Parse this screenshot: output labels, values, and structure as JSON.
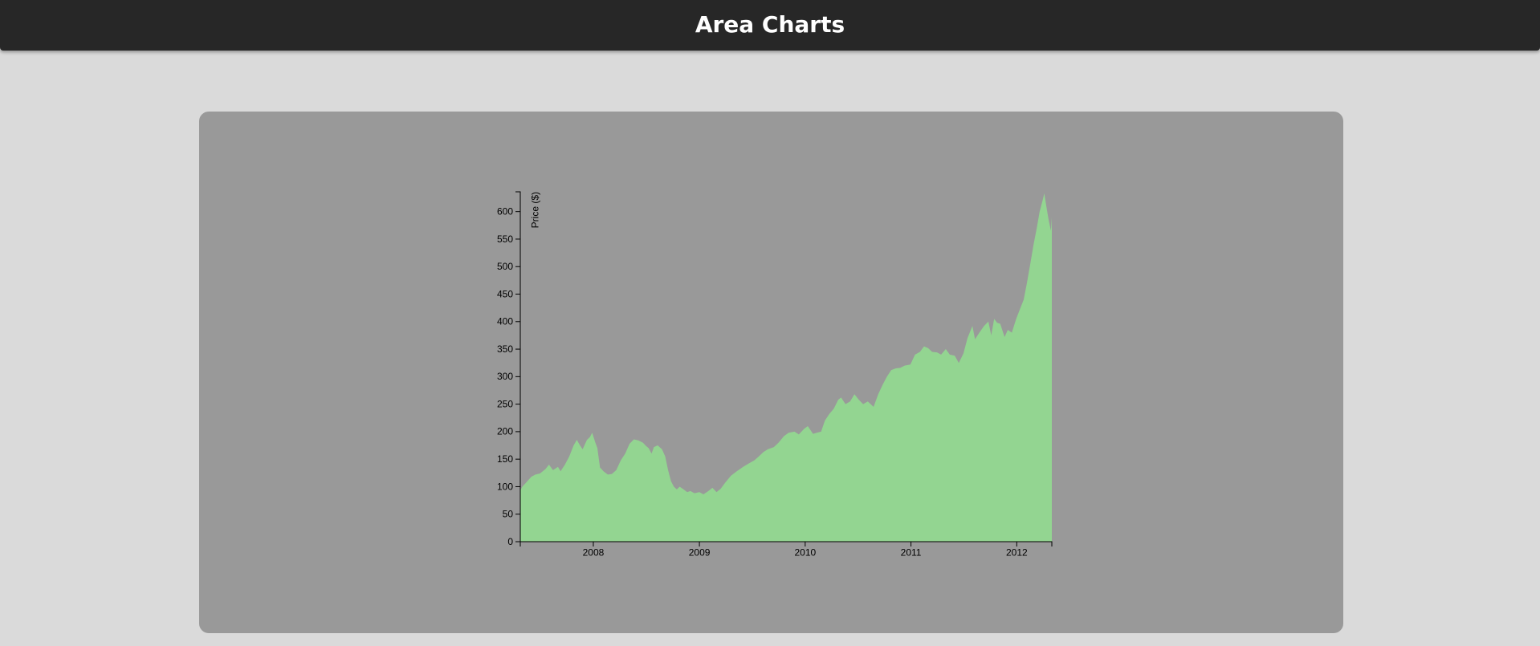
{
  "header": {
    "title": "Area Charts"
  },
  "colors": {
    "header_bg": "#272727",
    "page_bg": "#dadada",
    "panel_bg": "#999999",
    "area_fill": "#93d591"
  },
  "chart_data": {
    "type": "area",
    "ylabel": "Price ($)",
    "xlabel": "",
    "x_ticks": [
      "2008",
      "2009",
      "2010",
      "2011",
      "2012"
    ],
    "y_ticks": [
      0,
      50,
      100,
      150,
      200,
      250,
      300,
      350,
      400,
      450,
      500,
      550,
      600
    ],
    "xlim": [
      "2007-04-24",
      "2012-05-01"
    ],
    "ylim": [
      0,
      636
    ],
    "grid": false,
    "legend": "none",
    "series": [
      {
        "points": [
          [
            "2007-04-24",
            93
          ],
          [
            "2007-05-01",
            100
          ],
          [
            "2007-05-15",
            108
          ],
          [
            "2007-06-01",
            118
          ],
          [
            "2007-06-15",
            122
          ],
          [
            "2007-07-01",
            124
          ],
          [
            "2007-07-20",
            132
          ],
          [
            "2007-08-01",
            140
          ],
          [
            "2007-08-15",
            130
          ],
          [
            "2007-09-01",
            136
          ],
          [
            "2007-09-10",
            128
          ],
          [
            "2007-09-25",
            140
          ],
          [
            "2007-10-10",
            155
          ],
          [
            "2007-10-25",
            175
          ],
          [
            "2007-11-05",
            185
          ],
          [
            "2007-11-15",
            176
          ],
          [
            "2007-11-25",
            168
          ],
          [
            "2007-12-10",
            185
          ],
          [
            "2007-12-20",
            190
          ],
          [
            "2007-12-28",
            198
          ],
          [
            "2008-01-08",
            180
          ],
          [
            "2008-01-15",
            170
          ],
          [
            "2008-01-24",
            135
          ],
          [
            "2008-02-05",
            128
          ],
          [
            "2008-02-20",
            122
          ],
          [
            "2008-03-05",
            123
          ],
          [
            "2008-03-20",
            130
          ],
          [
            "2008-04-05",
            148
          ],
          [
            "2008-04-20",
            160
          ],
          [
            "2008-05-05",
            178
          ],
          [
            "2008-05-20",
            186
          ],
          [
            "2008-06-05",
            184
          ],
          [
            "2008-06-20",
            180
          ],
          [
            "2008-07-01",
            174
          ],
          [
            "2008-07-10",
            170
          ],
          [
            "2008-07-20",
            160
          ],
          [
            "2008-07-28",
            172
          ],
          [
            "2008-08-10",
            175
          ],
          [
            "2008-08-25",
            168
          ],
          [
            "2008-09-05",
            155
          ],
          [
            "2008-09-15",
            130
          ],
          [
            "2008-09-25",
            110
          ],
          [
            "2008-10-05",
            100
          ],
          [
            "2008-10-15",
            95
          ],
          [
            "2008-10-25",
            100
          ],
          [
            "2008-11-05",
            96
          ],
          [
            "2008-11-20",
            90
          ],
          [
            "2008-12-01",
            92
          ],
          [
            "2008-12-15",
            88
          ],
          [
            "2009-01-01",
            90
          ],
          [
            "2009-01-15",
            86
          ],
          [
            "2009-02-01",
            92
          ],
          [
            "2009-02-15",
            98
          ],
          [
            "2009-03-01",
            90
          ],
          [
            "2009-03-15",
            96
          ],
          [
            "2009-04-01",
            108
          ],
          [
            "2009-04-20",
            120
          ],
          [
            "2009-05-10",
            128
          ],
          [
            "2009-06-01",
            136
          ],
          [
            "2009-06-20",
            142
          ],
          [
            "2009-07-10",
            148
          ],
          [
            "2009-07-25",
            155
          ],
          [
            "2009-08-10",
            163
          ],
          [
            "2009-08-25",
            168
          ],
          [
            "2009-09-15",
            172
          ],
          [
            "2009-10-01",
            180
          ],
          [
            "2009-10-20",
            192
          ],
          [
            "2009-11-05",
            198
          ],
          [
            "2009-11-25",
            200
          ],
          [
            "2009-12-10",
            195
          ],
          [
            "2009-12-28",
            205
          ],
          [
            "2010-01-10",
            210
          ],
          [
            "2010-01-28",
            196
          ],
          [
            "2010-02-10",
            198
          ],
          [
            "2010-02-25",
            200
          ],
          [
            "2010-03-10",
            220
          ],
          [
            "2010-03-25",
            232
          ],
          [
            "2010-04-10",
            242
          ],
          [
            "2010-04-25",
            258
          ],
          [
            "2010-05-05",
            262
          ],
          [
            "2010-05-20",
            250
          ],
          [
            "2010-06-05",
            255
          ],
          [
            "2010-06-20",
            268
          ],
          [
            "2010-07-05",
            258
          ],
          [
            "2010-07-20",
            250
          ],
          [
            "2010-08-05",
            255
          ],
          [
            "2010-08-25",
            245
          ],
          [
            "2010-09-10",
            268
          ],
          [
            "2010-09-25",
            285
          ],
          [
            "2010-10-10",
            300
          ],
          [
            "2010-10-25",
            312
          ],
          [
            "2010-11-10",
            315
          ],
          [
            "2010-11-25",
            316
          ],
          [
            "2010-12-10",
            320
          ],
          [
            "2010-12-30",
            322
          ],
          [
            "2011-01-15",
            340
          ],
          [
            "2011-02-01",
            345
          ],
          [
            "2011-02-15",
            355
          ],
          [
            "2011-03-01",
            352
          ],
          [
            "2011-03-15",
            345
          ],
          [
            "2011-04-01",
            344
          ],
          [
            "2011-04-15",
            340
          ],
          [
            "2011-05-01",
            350
          ],
          [
            "2011-05-15",
            340
          ],
          [
            "2011-06-01",
            338
          ],
          [
            "2011-06-15",
            325
          ],
          [
            "2011-07-01",
            342
          ],
          [
            "2011-07-15",
            370
          ],
          [
            "2011-08-01",
            392
          ],
          [
            "2011-08-10",
            368
          ],
          [
            "2011-08-25",
            380
          ],
          [
            "2011-09-10",
            392
          ],
          [
            "2011-09-25",
            400
          ],
          [
            "2011-10-05",
            375
          ],
          [
            "2011-10-15",
            405
          ],
          [
            "2011-10-25",
            398
          ],
          [
            "2011-11-05",
            396
          ],
          [
            "2011-11-20",
            372
          ],
          [
            "2011-12-01",
            385
          ],
          [
            "2011-12-15",
            380
          ],
          [
            "2011-12-30",
            405
          ],
          [
            "2012-01-10",
            420
          ],
          [
            "2012-01-25",
            440
          ],
          [
            "2012-02-05",
            470
          ],
          [
            "2012-02-15",
            500
          ],
          [
            "2012-02-28",
            540
          ],
          [
            "2012-03-10",
            570
          ],
          [
            "2012-03-20",
            600
          ],
          [
            "2012-03-30",
            620
          ],
          [
            "2012-04-05",
            633
          ],
          [
            "2012-04-12",
            610
          ],
          [
            "2012-04-20",
            585
          ],
          [
            "2012-04-28",
            565
          ],
          [
            "2012-05-01",
            590
          ]
        ]
      }
    ]
  }
}
